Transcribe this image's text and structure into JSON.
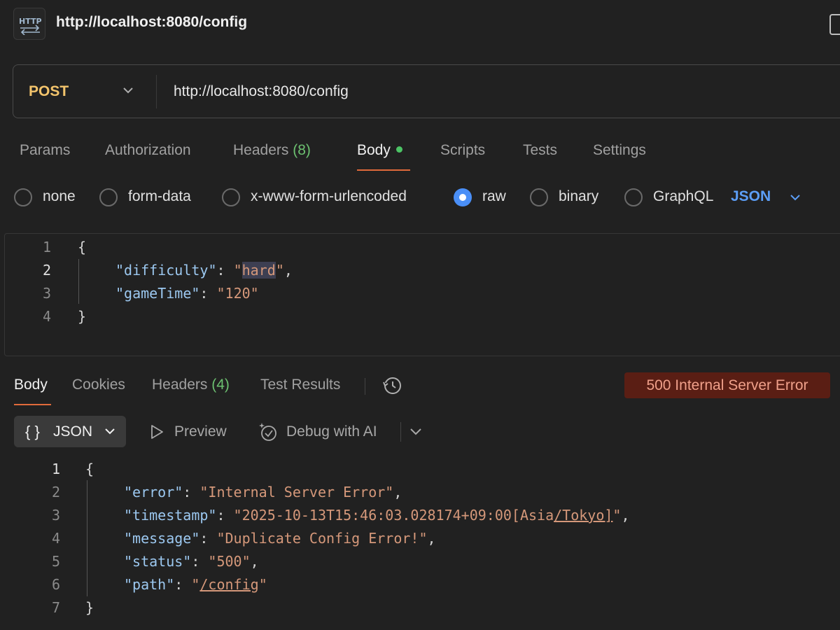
{
  "window": {
    "title": "http://localhost:8080/config",
    "badge_icon": "http-icon"
  },
  "request": {
    "method": "POST",
    "url": "http://localhost:8080/config",
    "tabs": [
      {
        "label": "Params"
      },
      {
        "label": "Authorization"
      },
      {
        "label": "Headers",
        "count": "(8)"
      },
      {
        "label": "Body",
        "active": true
      },
      {
        "label": "Scripts"
      },
      {
        "label": "Tests"
      },
      {
        "label": "Settings"
      }
    ],
    "body_types": [
      {
        "label": "none",
        "selected": false
      },
      {
        "label": "form-data",
        "selected": false
      },
      {
        "label": "x-www-form-urlencoded",
        "selected": false
      },
      {
        "label": "raw",
        "selected": true
      },
      {
        "label": "binary",
        "selected": false
      },
      {
        "label": "GraphQL",
        "selected": false
      }
    ],
    "format": "JSON",
    "body_lines": [
      {
        "n": "1",
        "text": "{"
      },
      {
        "n": "2",
        "key": "\"difficulty\"",
        "value_open": "\"",
        "value_sel": "hard",
        "value_close": "\"",
        "tail": ","
      },
      {
        "n": "3",
        "key": "\"gameTime\"",
        "value": "\"120\""
      },
      {
        "n": "4",
        "text": "}"
      }
    ]
  },
  "response": {
    "tabs": [
      {
        "label": "Body",
        "active": true
      },
      {
        "label": "Cookies"
      },
      {
        "label": "Headers",
        "count": "(4)"
      },
      {
        "label": "Test Results"
      }
    ],
    "status": "500 Internal Server Error",
    "status_color": "#5a1e14",
    "format": "JSON",
    "braces": "{ }",
    "preview_label": "Preview",
    "debug_label": "Debug with AI",
    "body_lines": [
      {
        "n": "1",
        "text": "{"
      },
      {
        "n": "2",
        "key": "\"error\"",
        "value": "\"Internal Server Error\"",
        "tail": ","
      },
      {
        "n": "3",
        "key": "\"timestamp\"",
        "value_a": "\"2025-10-13T15:46:03.028174+09:00[Asia",
        "value_link": "/Tokyo]",
        "value_b": "\"",
        "tail": ","
      },
      {
        "n": "4",
        "key": "\"message\"",
        "value": "\"Duplicate Config Error!\"",
        "tail": ","
      },
      {
        "n": "5",
        "key": "\"status\"",
        "value": "\"500\"",
        "tail": ","
      },
      {
        "n": "6",
        "key": "\"path\"",
        "value_a": "\"",
        "value_link": "/config",
        "value_b": "\""
      },
      {
        "n": "7",
        "text": "}"
      }
    ]
  },
  "colors": {
    "accent": "#e06a3b",
    "method": "#f3c46c",
    "radio_selected": "#4a8ff7",
    "json_key": "#9cc8f0",
    "json_string": "#d5987a"
  }
}
